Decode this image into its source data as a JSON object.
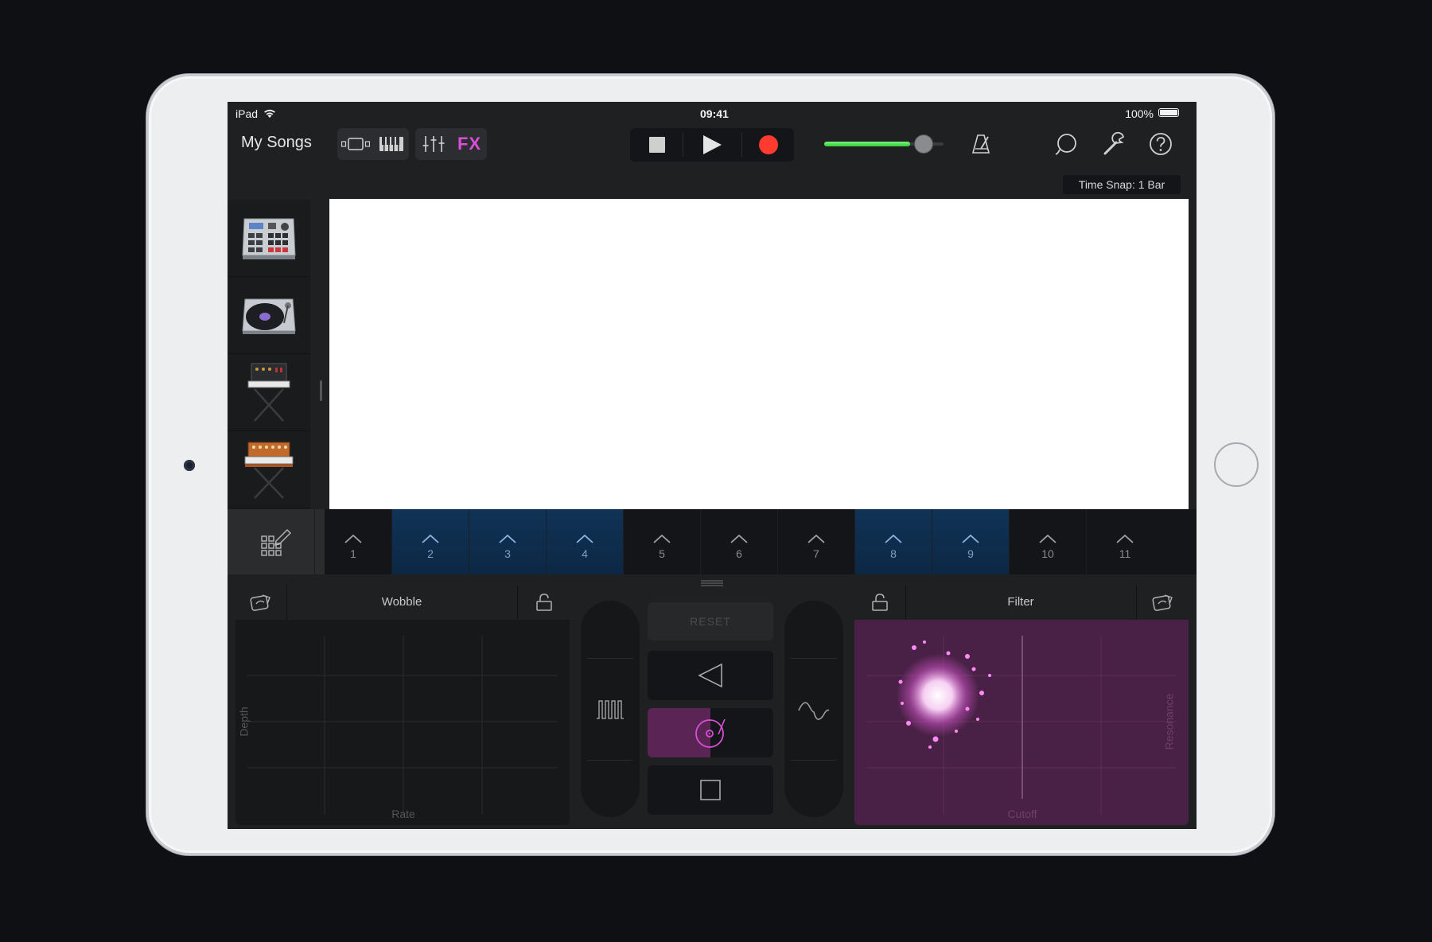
{
  "status_bar": {
    "device": "iPad",
    "time": "09:41",
    "battery": "100%"
  },
  "toolbar": {
    "my_songs": "My Songs",
    "fx_label": "FX",
    "time_snap": "Time Snap: 1 Bar",
    "master_volume": 0.72
  },
  "tracks": [
    {
      "name": "drum-machine"
    },
    {
      "name": "turntable"
    },
    {
      "name": "synth-on-stand"
    },
    {
      "name": "analog-synth-on-stand"
    }
  ],
  "loop_cells": [
    {
      "label": "1",
      "active": false
    },
    {
      "label": "2",
      "active": true
    },
    {
      "label": "3",
      "active": true
    },
    {
      "label": "4",
      "active": true
    },
    {
      "label": "5",
      "active": false
    },
    {
      "label": "6",
      "active": false
    },
    {
      "label": "7",
      "active": false
    },
    {
      "label": "8",
      "active": true
    },
    {
      "label": "9",
      "active": true
    },
    {
      "label": "10",
      "active": false
    },
    {
      "label": "11",
      "active": false
    }
  ],
  "fx": {
    "left_panel": {
      "title": "Wobble",
      "x_axis": "Rate",
      "y_axis": "Depth"
    },
    "right_panel": {
      "title": "Filter",
      "x_axis": "Cutoff",
      "y_axis": "Resonance"
    },
    "reset_label": "RESET"
  },
  "colors": {
    "accent": "#d94fd6",
    "record": "#ff3b30",
    "loop_active": "#103356",
    "filter_pad": "#4a2146"
  }
}
